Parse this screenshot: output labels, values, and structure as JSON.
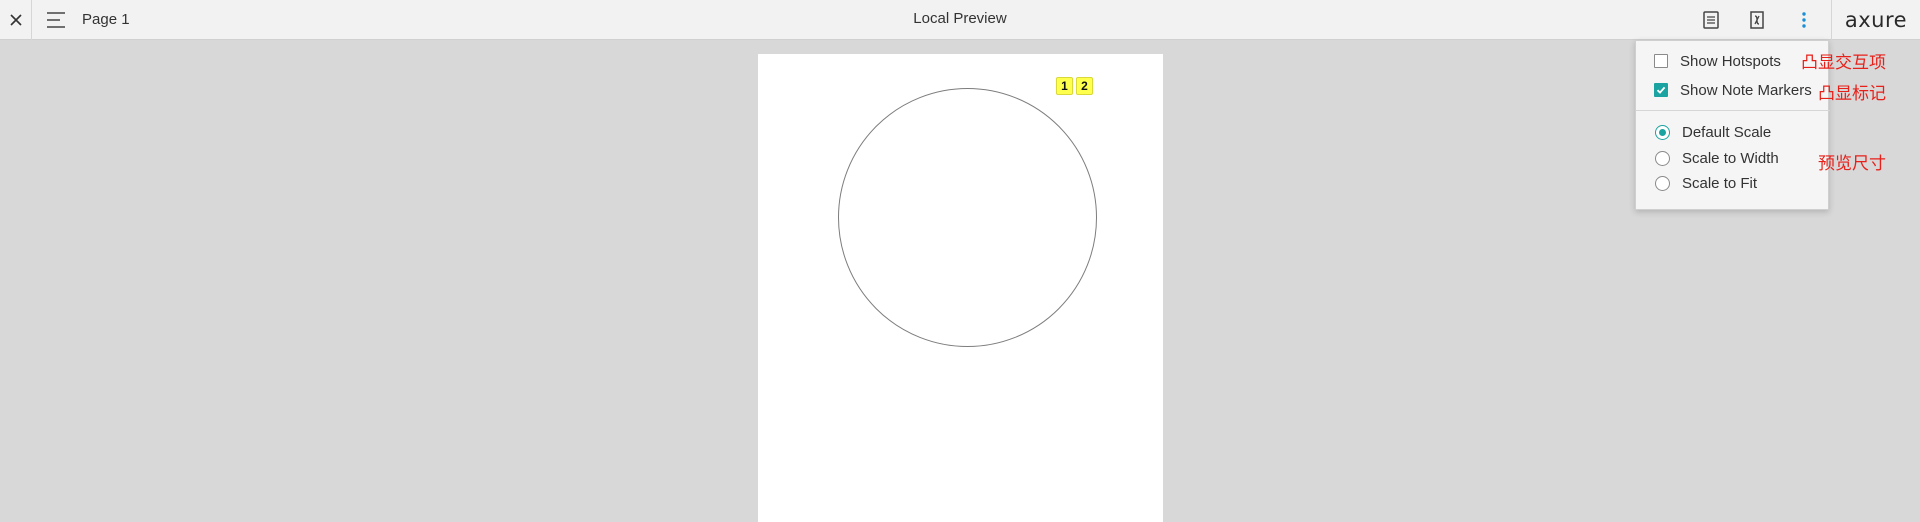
{
  "topbar": {
    "page_name": "Page 1",
    "title": "Local Preview",
    "logo": "axure",
    "icons": {
      "close": "close-icon",
      "menu": "hamburger-menu-icon",
      "notes": "notes-document-icon",
      "variables": "variables-icon",
      "more": "more-vertical-icon"
    },
    "accent_color": "#1a8fd6"
  },
  "canvas": {
    "note_markers": [
      "1",
      "2"
    ],
    "marker_color": "#ffff4d"
  },
  "dropdown": {
    "show_hotspots": {
      "label": "Show Hotspots",
      "checked": false
    },
    "show_note_markers": {
      "label": "Show Note Markers",
      "checked": true
    },
    "scale_options": [
      {
        "label": "Default Scale",
        "selected": true
      },
      {
        "label": "Scale to Width",
        "selected": false
      },
      {
        "label": "Scale to Fit",
        "selected": false
      }
    ],
    "accent_color": "#1aa3a0"
  },
  "annotations": {
    "hotspots": "凸显交互项",
    "markers": "凸显标记",
    "scale": "预览尺寸",
    "color": "#e8201a"
  }
}
